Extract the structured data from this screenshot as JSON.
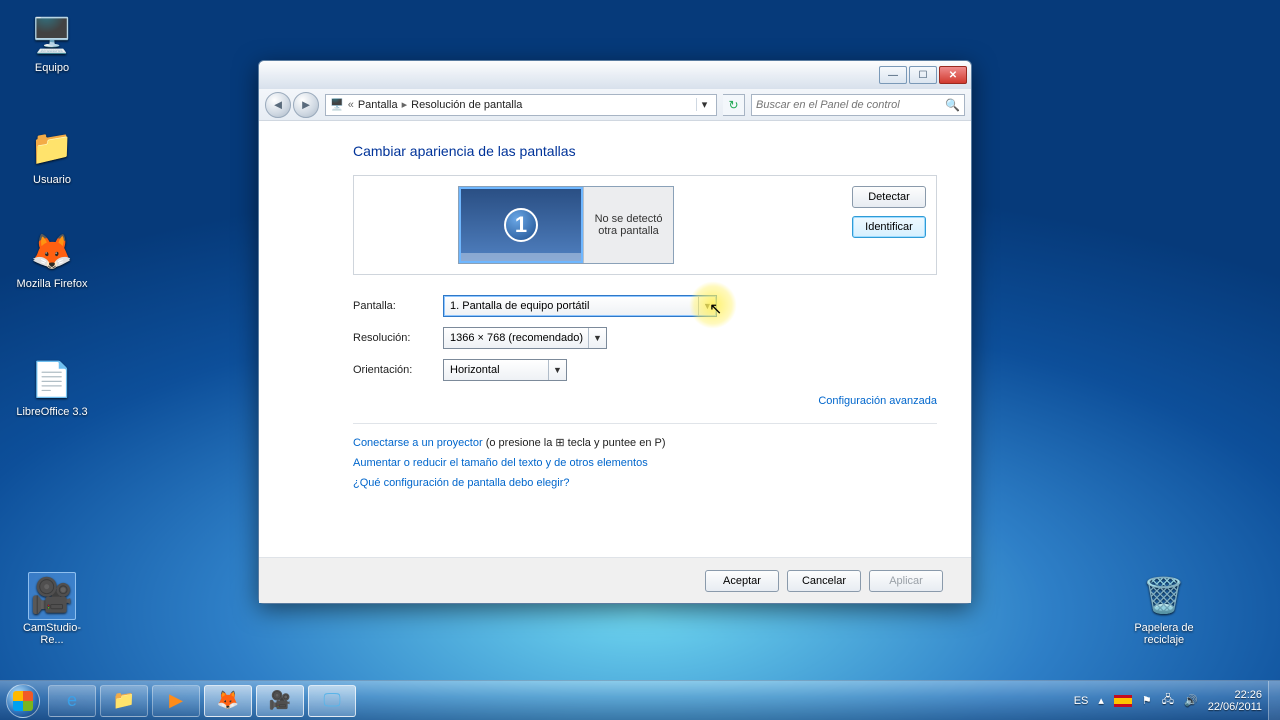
{
  "desktop": {
    "icons": [
      {
        "name": "Equipo",
        "glyph": "🖥️"
      },
      {
        "name": "Usuario",
        "glyph": "📁"
      },
      {
        "name": "Mozilla Firefox",
        "glyph": "🦊"
      },
      {
        "name": "LibreOffice 3.3",
        "glyph": "📄"
      },
      {
        "name": "CamStudio-Re...",
        "glyph": "🎥"
      }
    ],
    "recycle": {
      "name": "Papelera de reciclaje",
      "glyph": "🗑️"
    }
  },
  "window": {
    "breadcrumb": {
      "root_glyph": "🖥️",
      "sep1": "«",
      "crumb1": "Pantalla",
      "crumb2": "Resolución de pantalla"
    },
    "search_placeholder": "Buscar en el Panel de control",
    "title": "Cambiar apariencia de las pantallas",
    "preview": {
      "monitor_number": "1",
      "no_detect": "No se detectó otra pantalla",
      "detect_btn": "Detectar",
      "identify_btn": "Identificar"
    },
    "form": {
      "pantalla_label": "Pantalla:",
      "pantalla_value": "1. Pantalla de equipo portátil",
      "resolucion_label": "Resolución:",
      "resolucion_value": "1366 × 768 (recomendado)",
      "orientacion_label": "Orientación:",
      "orientacion_value": "Horizontal"
    },
    "advanced_link": "Configuración avanzada",
    "links": {
      "projector_link": "Conectarse a un proyector",
      "projector_hint_a": " (o presione la ",
      "projector_hint_b": " tecla y puntee en P)",
      "resize_link": "Aumentar o reducir el tamaño del texto y de otros elementos",
      "which_link": "¿Qué configuración de pantalla debo elegir?"
    },
    "footer": {
      "ok": "Aceptar",
      "cancel": "Cancelar",
      "apply": "Aplicar"
    }
  },
  "taskbar": {
    "lang": "ES",
    "time": "22:26",
    "date": "22/06/2011"
  }
}
